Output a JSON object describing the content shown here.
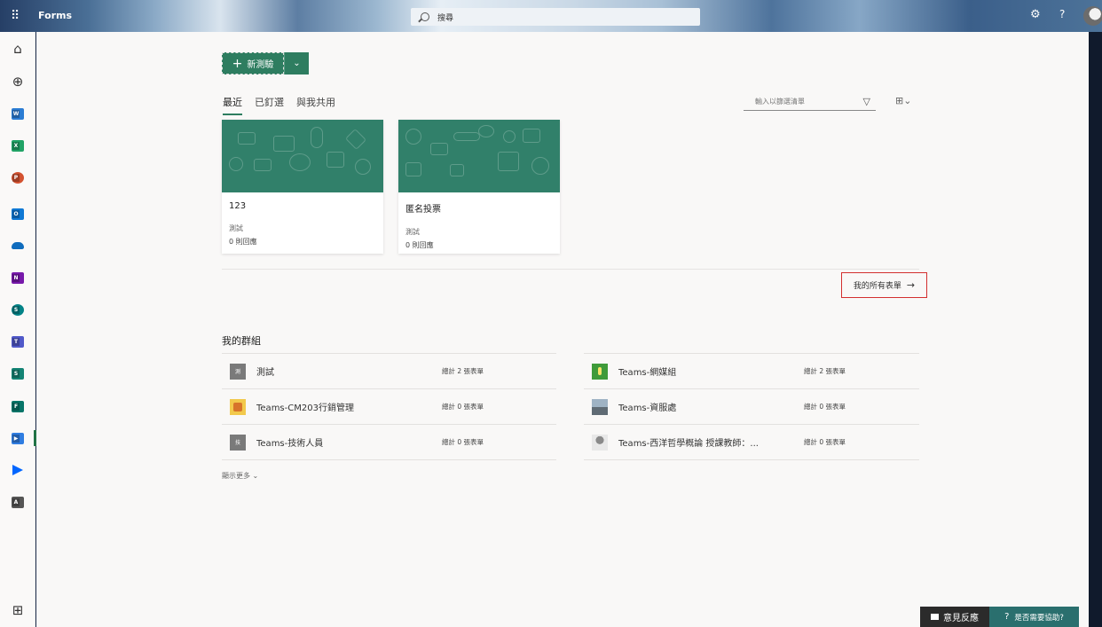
{
  "topbar": {
    "app_name": "Forms",
    "search_placeholder": "搜尋",
    "help_icon": "?"
  },
  "toolbar": {
    "new_label": "新測驗"
  },
  "tabs": [
    {
      "label": "最近",
      "active": true
    },
    {
      "label": "已釘選",
      "active": false
    },
    {
      "label": "與我共用",
      "active": false
    }
  ],
  "filter": {
    "placeholder": "輸入以篩選清單"
  },
  "cards": [
    {
      "title": "123",
      "subtitle": "測試",
      "responses": "0 則回應"
    },
    {
      "title": "匿名投票",
      "subtitle": "測試",
      "responses": "0 則回應"
    }
  ],
  "all_forms_link": "我的所有表單",
  "groups": {
    "heading": "我的群組",
    "items": [
      {
        "name": "測試",
        "count": "總計 2 張表單",
        "icon_text": "測",
        "icon_color": "#7a7a7a"
      },
      {
        "name": "Teams-網媒組",
        "count": "總計 2 張表單",
        "icon_text": "",
        "icon_color": "#3f9b3a"
      },
      {
        "name": "Teams-CM203行銷管理",
        "count": "總計 0 張表單",
        "icon_text": "",
        "icon_color": "#d7742a"
      },
      {
        "name": "Teams-資服處",
        "count": "總計 0 張表單",
        "icon_text": "",
        "icon_color": "#6c7a88"
      },
      {
        "name": "Teams-技術人員",
        "count": "總計 0 張表單",
        "icon_text": "技",
        "icon_color": "#7a7a7a"
      },
      {
        "name": "Teams-西洋哲學概論 授課教師：...",
        "count": "總計 0 張表單",
        "icon_text": "",
        "icon_color": "#bfbfbf"
      }
    ],
    "show_more": "顯示更多"
  },
  "footer": {
    "feedback": "意見反應",
    "help": "是否需要協助?"
  },
  "colors": {
    "accent": "#2e7d60",
    "highlight_box": "#d32f2f"
  },
  "rail_icons": [
    "home-icon",
    "create-icon",
    "word-icon",
    "excel-icon",
    "powerpoint-icon",
    "outlook-icon",
    "onedrive-icon",
    "onenote-icon",
    "sharepoint-icon",
    "teams-icon",
    "sway-icon",
    "forms-icon",
    "stream-icon",
    "power-automate-icon",
    "office-icon",
    "all-apps-icon"
  ]
}
